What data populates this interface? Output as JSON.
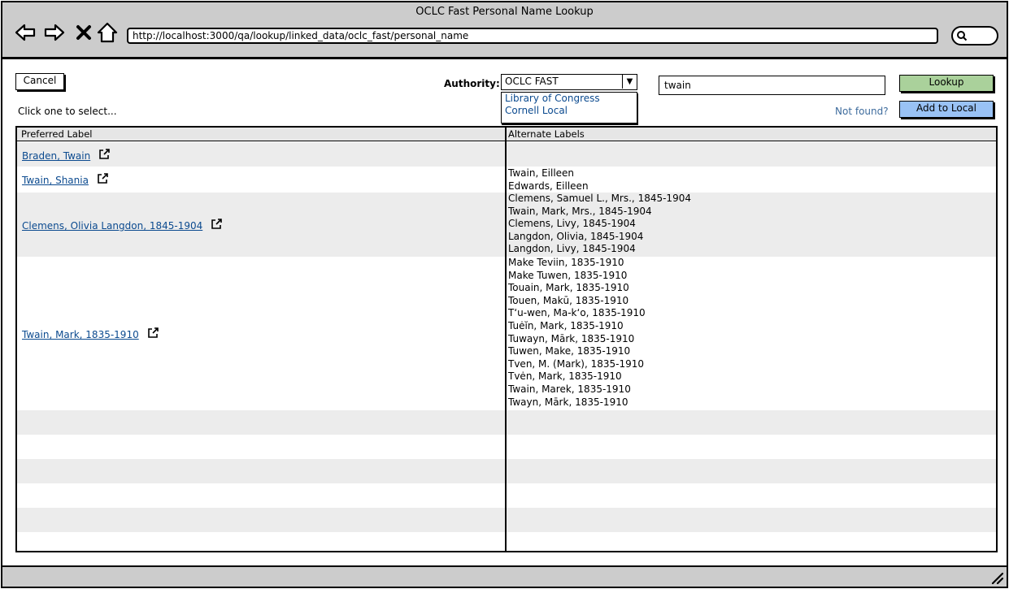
{
  "window": {
    "title": "OCLC Fast Personal Name Lookup",
    "url": "http://localhost:3000/qa/lookup/linked_data/oclc_fast/personal_name"
  },
  "icons": {
    "back": "back-arrow-icon",
    "forward": "forward-arrow-icon",
    "stop": "close-icon",
    "home": "home-icon",
    "search": "search-icon",
    "external": "external-link-icon",
    "resize": "resize-grip-icon"
  },
  "toolbar": {
    "cancel_label": "Cancel",
    "authority_label": "Authority:",
    "authority_selected": "OCLC FAST",
    "authority_options": [
      "Library of Congress",
      "Cornell Local"
    ],
    "search_value": "twain",
    "lookup_label": "Lookup",
    "not_found_label": "Not found?",
    "add_local_label": "Add to Local",
    "instruction": "Click one to select..."
  },
  "colors": {
    "lookup_button": "#aad19b",
    "add_local_button": "#99c2f5",
    "link": "#0b4a8f",
    "row_shade": "#ececec"
  },
  "table": {
    "headers": [
      "Preferred Label",
      "Alternate Labels"
    ],
    "rows": [
      {
        "preferred": "Braden, Twain",
        "alternates": []
      },
      {
        "preferred": "Twain, Shania",
        "alternates": [
          "Twain, Eilleen",
          "Edwards, Eilleen"
        ]
      },
      {
        "preferred": "Clemens, Olivia Langdon, 1845-1904",
        "alternates": [
          "Clemens, Samuel L., Mrs., 1845-1904",
          "Twain, Mark, Mrs., 1845-1904",
          "Clemens, Livy, 1845-1904",
          "Langdon, Olivia, 1845-1904",
          "Langdon, Livy, 1845-1904"
        ]
      },
      {
        "preferred": "Twain, Mark, 1835-1910",
        "alternates": [
          "Make Teviin, 1835-1910",
          "Make Tuwen, 1835-1910",
          "Touain, Mark, 1835-1910",
          "Touen, Makū, 1835-1910",
          "Tʻu-wen, Ma-kʻo, 1835-1910",
          "Tuėĭn, Mark, 1835-1910",
          "Tuwayn, Mārk, 1835-1910",
          "Tuwen, Make, 1835-1910",
          "Tven, M. (Mark), 1835-1910",
          "Tvėn, Mark, 1835-1910",
          "Twain, Marek, 1835-1910",
          "Twayn, Mārk, 1835-1910"
        ]
      }
    ]
  }
}
